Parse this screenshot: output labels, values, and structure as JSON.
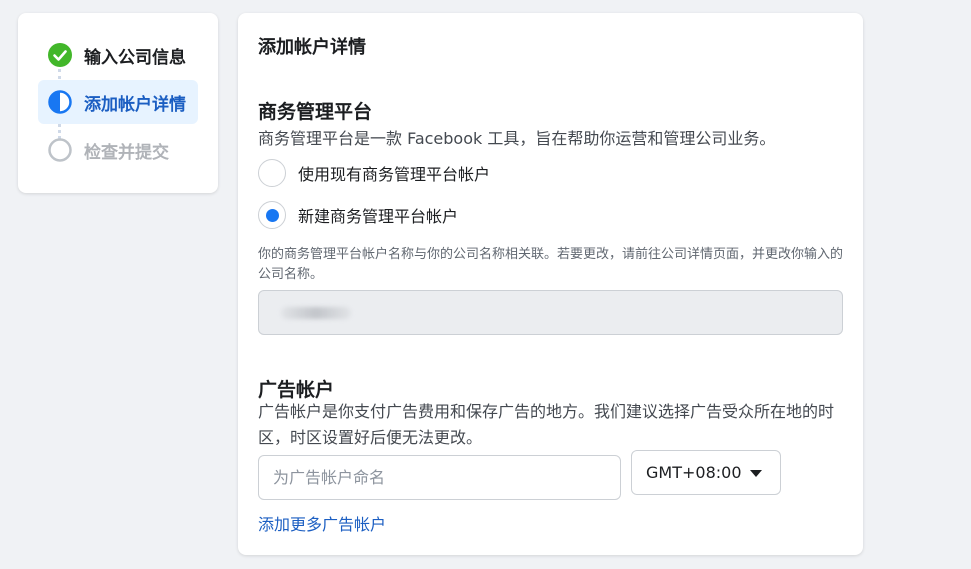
{
  "steps": [
    {
      "label": "输入公司信息",
      "state": "done"
    },
    {
      "label": "添加帐户详情",
      "state": "current"
    },
    {
      "label": "检查并提交",
      "state": "pending"
    }
  ],
  "main": {
    "title": "添加帐户详情",
    "business": {
      "title": "商务管理平台",
      "description": "商务管理平台是一款 Facebook 工具，旨在帮助你运营和管理公司业务。",
      "options": [
        {
          "label": "使用现有商务管理平台帐户",
          "checked": false
        },
        {
          "label": "新建商务管理平台帐户",
          "checked": true
        }
      ],
      "note": "你的商务管理平台帐户名称与你的公司名称相关联。若要更改，请前往公司详情页面，并更改你输入的公司名称。"
    },
    "ad_account": {
      "title": "广告帐户",
      "description": "广告帐户是你支付广告费用和保存广告的地方。我们建议选择广告受众所在地的时区，时区设置好后便无法更改。",
      "name_placeholder": "为广告帐户命名",
      "timezone": "GMT+08:00",
      "add_more_label": "添加更多广告帐户"
    }
  },
  "colors": {
    "accent": "#1877f2",
    "link": "#1b5ec2",
    "success": "#42b72a",
    "current_step_bg": "#e7f3ff"
  },
  "icons": [
    "check-circle-icon",
    "half-circle-icon",
    "empty-circle-icon",
    "caret-down-icon"
  ]
}
